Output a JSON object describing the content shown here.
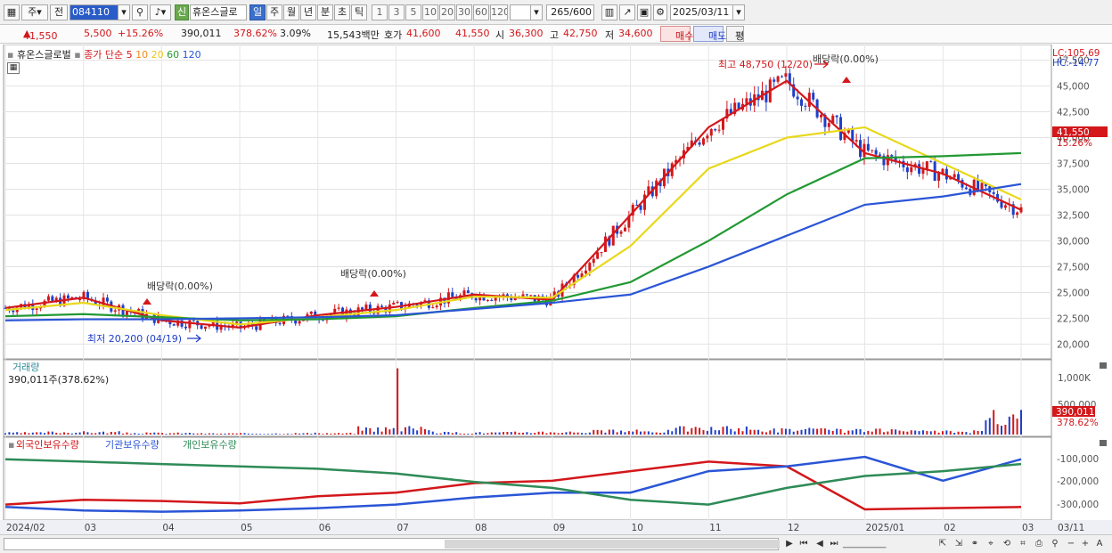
{
  "toolbar": {
    "period": "주",
    "mode": "전",
    "code": "084110",
    "badge": "신",
    "stock_name": "휴온스글로",
    "tabs": [
      "일",
      "주",
      "월",
      "년",
      "분",
      "초",
      "틱"
    ],
    "active_tab": "일",
    "intervals": [
      "1",
      "3",
      "5",
      "10",
      "20",
      "30",
      "60",
      "120"
    ],
    "count": "265",
    "count_max": "/600",
    "date": "2025/03/11"
  },
  "quote": {
    "price": "41,550",
    "change": "5,500",
    "change_pct": "+15.26%",
    "volume": "390,011",
    "volume_pct": "378.62%",
    "turnover_pct": "3.09%",
    "amount": "15,543백만",
    "ask_label": "호가",
    "ask": "41,600",
    "bid": "41,550",
    "open_label": "시",
    "open": "36,300",
    "high_label": "고",
    "high": "42,750",
    "low_label": "저",
    "low": "34,600",
    "buy": "매수",
    "sell": "매도",
    "eval": "평"
  },
  "price_panel": {
    "name": "휴온스글로벌",
    "legend_prefix": "종가 단순",
    "ma": [
      {
        "period": "5",
        "color": "#d3171b"
      },
      {
        "period": "10",
        "color": "#f08c1a"
      },
      {
        "period": "20",
        "color": "#e8d81a"
      },
      {
        "period": "60",
        "color": "#229933"
      },
      {
        "period": "120",
        "color": "#2a55d6"
      }
    ],
    "lc": "LC:105.69",
    "hc": "HC:-14.77",
    "current": "41,550",
    "current_pct": "15.26%",
    "annotations": {
      "div1": "배당락(0.00%)",
      "div2": "배당락(0.00%)",
      "div3": "배당락(0.00%)",
      "high": "최고 48,750 (12/20)",
      "low": "최저 20,200 (04/19)"
    }
  },
  "volume_panel": {
    "title": "거래량",
    "value": "390,011주(378.62%)",
    "tick_1000k": "1,000K",
    "tick_500k": "500,000",
    "current": "390,011",
    "current_pct": "378.62%"
  },
  "flow_panel": {
    "titles": [
      {
        "label": "외국인보유수량",
        "color": "#d3171b"
      },
      {
        "label": "기관보유수량",
        "color": "#2a55d6"
      },
      {
        "label": "개인보유수량",
        "color": "#2e8b57"
      }
    ],
    "ticks": [
      "-100,000",
      "-200,000",
      "-300,000"
    ]
  },
  "x_axis": [
    "2024/02",
    "03",
    "04",
    "05",
    "06",
    "07",
    "08",
    "09",
    "10",
    "11",
    "12",
    "2025/01",
    "02",
    "03",
    "03/11"
  ],
  "chart_data": {
    "type": "line",
    "title": "휴온스글로벌",
    "ylim": [
      19000,
      48500
    ],
    "y_ticks": [
      20000,
      22500,
      25000,
      27500,
      30000,
      32500,
      35000,
      37500,
      40000,
      42500,
      45000,
      47500
    ],
    "x": [
      "2024/02",
      "03",
      "04",
      "05",
      "06",
      "07",
      "08",
      "09",
      "10",
      "11",
      "12",
      "2025/01",
      "02",
      "03"
    ],
    "series": [
      {
        "name": "5",
        "color": "#d3171b",
        "values": [
          23500,
          24500,
          22300,
          21600,
          22800,
          23600,
          24800,
          24300,
          32500,
          41000,
          45500,
          38500,
          36500,
          33000
        ]
      },
      {
        "name": "20",
        "color": "#e8d81a",
        "values": [
          23300,
          24000,
          22800,
          21900,
          22600,
          23300,
          24600,
          24500,
          29500,
          37000,
          40000,
          41000,
          37500,
          34000
        ]
      },
      {
        "name": "60",
        "color": "#229933",
        "values": [
          22700,
          22900,
          22600,
          22300,
          22400,
          22700,
          23500,
          24200,
          26000,
          30000,
          34500,
          38000,
          38200,
          38500
        ]
      },
      {
        "name": "120",
        "color": "#2a55d6",
        "values": [
          22300,
          22400,
          22400,
          22500,
          22600,
          22800,
          23400,
          24000,
          24800,
          27500,
          30500,
          33500,
          34300,
          35500
        ]
      }
    ],
    "volume": [
      40,
      55,
      35,
      25,
      30,
      1050,
      45,
      60,
      80,
      140,
      110,
      95,
      70,
      390
    ],
    "volume_ticks": [
      500000,
      1000000
    ],
    "flows": [
      {
        "name": "외국인보유수량",
        "color": "#d3171b",
        "values": [
          -290000,
          -270000,
          -275000,
          -285000,
          -255000,
          -240000,
          -200000,
          -190000,
          -150000,
          -110000,
          -130000,
          -310000,
          -305000,
          -300000
        ]
      },
      {
        "name": "기관보유수량",
        "color": "#2a55d6",
        "values": [
          -300000,
          -315000,
          -320000,
          -315000,
          -305000,
          -290000,
          -260000,
          -240000,
          -240000,
          -150000,
          -130000,
          -90000,
          -190000,
          -100000
        ]
      },
      {
        "name": "개인보유수량",
        "color": "#2e8b57",
        "values": [
          -100000,
          -110000,
          -120000,
          -130000,
          -140000,
          -160000,
          -195000,
          -220000,
          -270000,
          -290000,
          -220000,
          -170000,
          -150000,
          -120000
        ]
      }
    ]
  }
}
